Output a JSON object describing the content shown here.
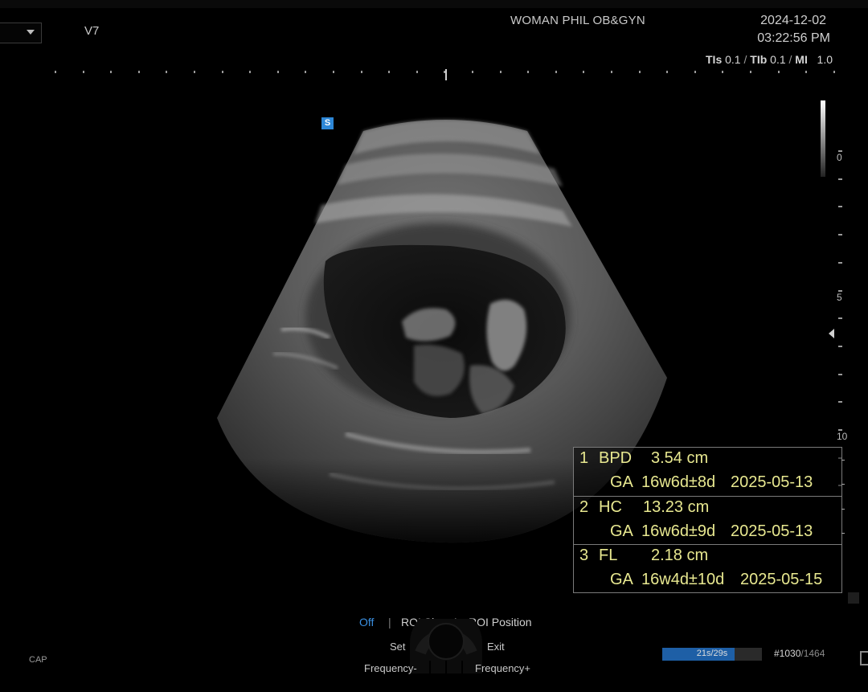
{
  "header": {
    "probe": "V7",
    "hospital": "WOMAN PHIL OB&GYN",
    "date": "2024-12-02",
    "time": "03:22:56 PM",
    "thermal": {
      "tis_label": "TIs",
      "tis_value": "0.1",
      "tib_label": "TIb",
      "tib_value": "0.1",
      "mi_label": "MI",
      "mi_value": "1.0",
      "separator": "/"
    }
  },
  "image": {
    "badge": "S",
    "depth_labels": [
      "0",
      "5",
      "10"
    ]
  },
  "measurements": [
    {
      "index": "1",
      "name": "BPD",
      "value": "3.54 cm",
      "ga_label": "GA",
      "ga": "16w6d±8d",
      "edd": "2025-05-13"
    },
    {
      "index": "2",
      "name": "HC",
      "value": "13.23 cm",
      "ga_label": "GA",
      "ga": "16w6d±9d",
      "edd": "2025-05-13"
    },
    {
      "index": "3",
      "name": "FL",
      "value": "2.18 cm",
      "ga_label": "GA",
      "ga": "16w4d±10d",
      "edd": "2025-05-15"
    }
  ],
  "softkeys": {
    "off": "Off",
    "divider": "|",
    "roi_size": "ROI Size",
    "roi_position": "ROI Position",
    "set": "Set",
    "exit": "Exit",
    "freq_minus": "Frequency-",
    "freq_plus": "Frequency+"
  },
  "footer": {
    "cap": "CAP",
    "cine_text": "21s/29s",
    "cine_fraction": 0.724,
    "frame_current": "#1030",
    "frame_total": "/1464"
  },
  "colors": {
    "measurement_text": "#e8e890",
    "active_softkey": "#3a8fe0",
    "cine_fill": "#1e5fa6",
    "badge": "#2d87d7"
  },
  "icons": [
    "dropdown-arrow-icon",
    "focus-marker-icon",
    "control-knob-icon"
  ]
}
